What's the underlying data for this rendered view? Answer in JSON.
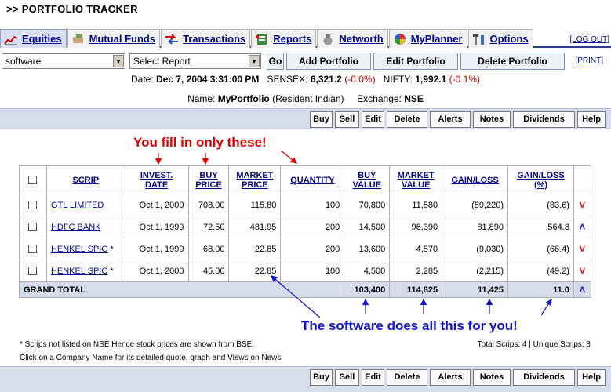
{
  "header": {
    "title": ">> PORTFOLIO TRACKER"
  },
  "tabs": [
    {
      "label": "Equities",
      "icon": "chart-icon"
    },
    {
      "label": "Mutual Funds",
      "icon": "hand-money-icon"
    },
    {
      "label": "Transactions",
      "icon": "arrows-icon"
    },
    {
      "label": "Reports",
      "icon": "report-icon"
    },
    {
      "label": "Networth",
      "icon": "money-bag-icon"
    },
    {
      "label": "MyPlanner",
      "icon": "planner-icon"
    },
    {
      "label": "Options",
      "icon": "options-icon"
    }
  ],
  "logout_label": "[LOG OUT]",
  "toolbar": {
    "portfolio_select": "software",
    "report_select": "Select Report",
    "go_label": "Go",
    "add_label": "Add Portfolio",
    "edit_label": "Edit Portfolio",
    "delete_label": "Delete Portfolio",
    "print_label": "[PRINT]"
  },
  "info": {
    "date_label": "Date:",
    "date_value": "Dec 7, 2004 3:31:00 PM",
    "sensex_label": "SENSEX:",
    "sensex_value": "6,321.2",
    "sensex_change": "(-0.0%)",
    "nifty_label": "NIFTY:",
    "nifty_value": "1,992.1",
    "nifty_change": "(-0.1%)",
    "name_label": "Name:",
    "name_value": "MyPortfolio",
    "name_note": "(Resident Indian)",
    "exchange_label": "Exchange:",
    "exchange_value": "NSE"
  },
  "actions": [
    "Buy",
    "Sell",
    "Edit",
    "Delete",
    "Alerts",
    "Notes",
    "Dividends",
    "Help"
  ],
  "callouts": {
    "top": "You fill in only these!",
    "bottom": "The software does all this for you!"
  },
  "table": {
    "headers": {
      "scrip": "SCRIP",
      "invest1": "INVEST.",
      "invest2": "DATE",
      "buy1": "BUY",
      "buy2": "PRICE",
      "mkt1": "MARKET",
      "mkt2": "PRICE",
      "qty": "QUANTITY",
      "bv1": "BUY",
      "bv2": "VALUE",
      "mv1": "MARKET",
      "mv2": "VALUE",
      "gl": "GAIN/LOSS",
      "glp1": "GAIN/LOSS",
      "glp2": "(%)"
    },
    "rows": [
      {
        "scrip": "GTL LIMITED",
        "star": "",
        "date": "Oct 1, 2000",
        "buy_price": "708.00",
        "market_price": "115.80",
        "quantity": "100",
        "buy_value": "70,800",
        "market_value": "11,580",
        "gain_loss": "(59,220)",
        "gain_loss_pct": "(83.6)",
        "trend": "down"
      },
      {
        "scrip": "HDFC BANK",
        "star": "",
        "date": "Oct 1, 1999",
        "buy_price": "72.50",
        "market_price": "481.95",
        "quantity": "200",
        "buy_value": "14,500",
        "market_value": "96,390",
        "gain_loss": "81,890",
        "gain_loss_pct": "564.8",
        "trend": "up"
      },
      {
        "scrip": "HENKEL SPIC",
        "star": "*",
        "date": "Oct 1, 1999",
        "buy_price": "68.00",
        "market_price": "22.85",
        "quantity": "200",
        "buy_value": "13,600",
        "market_value": "4,570",
        "gain_loss": "(9,030)",
        "gain_loss_pct": "(66.4)",
        "trend": "down"
      },
      {
        "scrip": "HENKEL SPIC",
        "star": "*",
        "date": "Oct 1, 2000",
        "buy_price": "45.00",
        "market_price": "22.85",
        "quantity": "100",
        "buy_value": "4,500",
        "market_value": "2,285",
        "gain_loss": "(2,215)",
        "gain_loss_pct": "(49.2)",
        "trend": "down"
      }
    ],
    "total": {
      "label": "GRAND TOTAL",
      "buy_value": "103,400",
      "market_value": "114,825",
      "gain_loss": "11,425",
      "gain_loss_pct": "11.0",
      "trend": "up"
    }
  },
  "footer": {
    "note1": "* Scrips not listed on NSE Hence stock prices are shown from BSE.",
    "note2": "Click on a Company Name for its detailed quote, graph and Views on News",
    "totals": "Total Scrips: 4 | Unique Scrips: 3"
  },
  "colors": {
    "accent": "#00058a",
    "down": "#e00000",
    "up": "#1010d8",
    "bar": "#d6dcec"
  }
}
